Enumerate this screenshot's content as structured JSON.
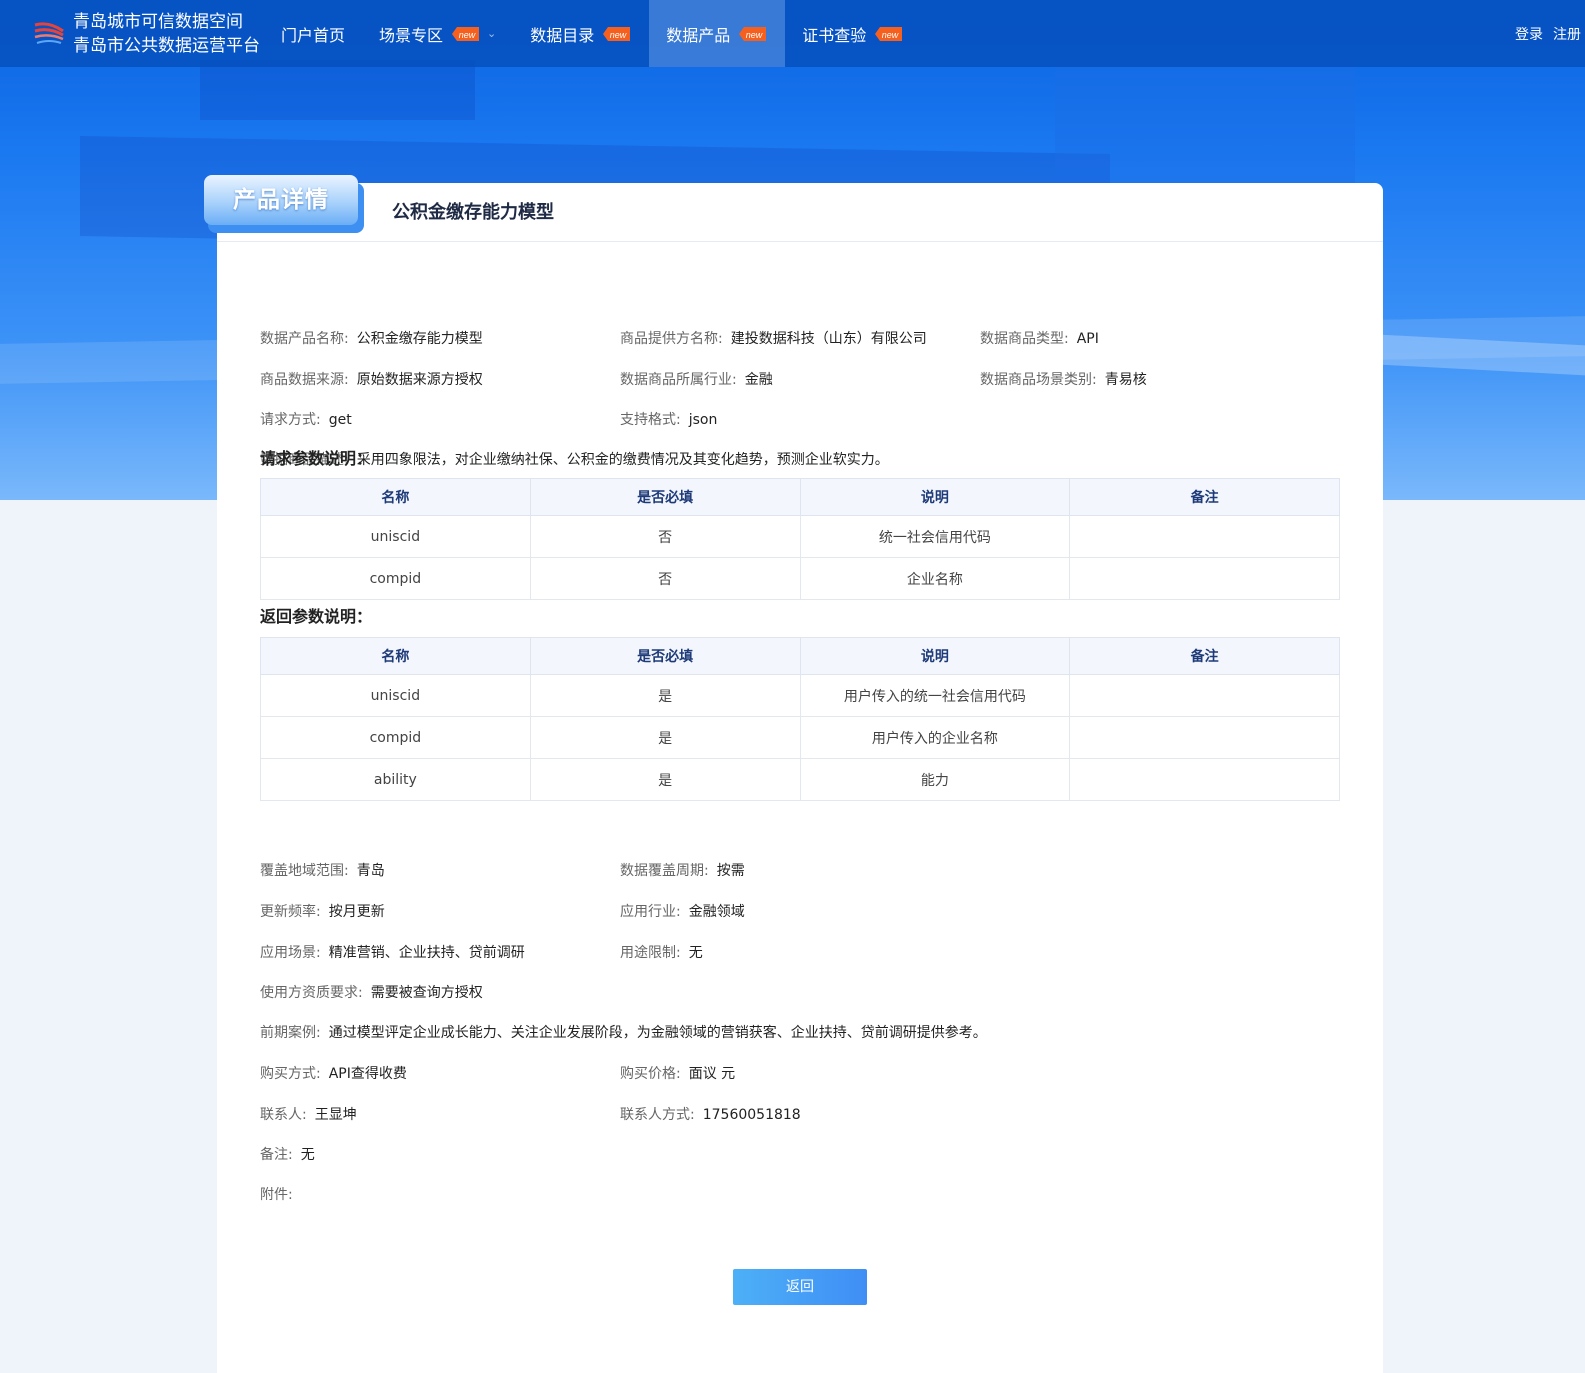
{
  "header": {
    "logo_line1": "青岛城市可信数据空间",
    "logo_line2": "青岛市公共数据运营平台",
    "nav": [
      {
        "label": "门户首页",
        "badge": "",
        "dropdown": false,
        "active": false
      },
      {
        "label": "场景专区",
        "badge": "new",
        "dropdown": true,
        "active": false
      },
      {
        "label": "数据目录",
        "badge": "new",
        "dropdown": false,
        "active": false
      },
      {
        "label": "数据产品",
        "badge": "new",
        "dropdown": false,
        "active": true
      },
      {
        "label": "证书查验",
        "badge": "new",
        "dropdown": false,
        "active": false
      }
    ],
    "login": "登录",
    "register": "注册"
  },
  "card": {
    "tag": "产品详情",
    "title": "公积金缴存能力模型"
  },
  "info_top": {
    "product_name": {
      "label": "数据产品名称:",
      "value": "公积金缴存能力模型"
    },
    "provider": {
      "label": "商品提供方名称:",
      "value": "建投数据科技（山东）有限公司"
    },
    "type": {
      "label": "数据商品类型:",
      "value": "API"
    },
    "source": {
      "label": "商品数据来源:",
      "value": "原始数据来源方授权"
    },
    "industry": {
      "label": "数据商品所属行业:",
      "value": "金融"
    },
    "scene": {
      "label": "数据商品场景类别:",
      "value": "青易核"
    },
    "method": {
      "label": "请求方式:",
      "value": "get"
    },
    "format": {
      "label": "支持格式:",
      "value": "json"
    },
    "desc": {
      "label": "数据商品描述:",
      "value": "采用四象限法，对企业缴纳社保、公积金的缴费情况及其变化趋势，预测企业软实力。"
    }
  },
  "request_params": {
    "title": "请求参数说明：",
    "headers": [
      "名称",
      "是否必填",
      "说明",
      "备注"
    ],
    "rows": [
      [
        "uniscid",
        "否",
        "统一社会信用代码",
        ""
      ],
      [
        "compid",
        "否",
        "企业名称",
        ""
      ]
    ]
  },
  "response_params": {
    "title": "返回参数说明：",
    "headers": [
      "名称",
      "是否必填",
      "说明",
      "备注"
    ],
    "rows": [
      [
        "uniscid",
        "是",
        "用户传入的统一社会信用代码",
        ""
      ],
      [
        "compid",
        "是",
        "用户传入的企业名称",
        ""
      ],
      [
        "ability",
        "是",
        "能力",
        ""
      ]
    ]
  },
  "info_bottom": {
    "coverage_area": {
      "label": "覆盖地域范围:",
      "value": "青岛"
    },
    "coverage_period": {
      "label": "数据覆盖周期:",
      "value": "按需"
    },
    "update_freq": {
      "label": "更新频率:",
      "value": "按月更新"
    },
    "app_industry": {
      "label": "应用行业:",
      "value": "金融领域"
    },
    "app_scene": {
      "label": "应用场景:",
      "value": "精准营销、企业扶持、贷前调研"
    },
    "usage_limit": {
      "label": "用途限制:",
      "value": "无"
    },
    "qualification": {
      "label": "使用方资质要求:",
      "value": "需要被查询方授权"
    },
    "cases": {
      "label": "前期案例:",
      "value": "通过模型评定企业成长能力、关注企业发展阶段，为金融领域的营销获客、企业扶持、贷前调研提供参考。"
    },
    "buy_method": {
      "label": "购买方式:",
      "value": "API查得收费"
    },
    "price": {
      "label": "购买价格:",
      "value": "面议 元"
    },
    "contact": {
      "label": "联系人:",
      "value": "王显坤"
    },
    "contact_phone": {
      "label": "联系人方式:",
      "value": "17560051818"
    },
    "remark": {
      "label": "备注:",
      "value": "无"
    },
    "attachment": {
      "label": "附件:",
      "value": ""
    }
  },
  "back_button": "返回"
}
